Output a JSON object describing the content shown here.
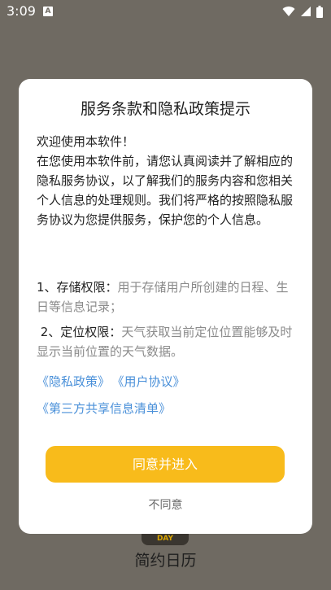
{
  "status_bar": {
    "time": "3:09",
    "notification_badge": "A"
  },
  "dialog": {
    "title": "服务条款和隐私政策提示",
    "welcome": "欢迎使用本软件！",
    "intro": "在您使用本软件前，请您认真阅读并了解相应的隐私服务协议，以了解我们的服务内容和您相关个人信息的处理规则。我们将严格的按照隐私服务协议为您提供服务，保护您的个人信息。",
    "permissions": [
      {
        "label": "1、存储权限：",
        "desc": "用于存储用户所创建的日程、生日等信息记录；"
      },
      {
        "label": " 2、定位权限：",
        "desc": "天气获取当前定位位置能够及时显示当前位置的天气数据。"
      }
    ],
    "links": {
      "privacy_policy": "《隐私政策》",
      "user_agreement": "《用户协议》",
      "third_party_list": "《第三方共享信息清单》"
    },
    "agree_button": "同意并进入",
    "disagree_button": "不同意"
  },
  "background_app": {
    "badge": "DAY",
    "name": "简约日历"
  },
  "colors": {
    "overlay": "#6f6a62",
    "accent": "#f8bb1b",
    "link": "#4a90d9"
  }
}
